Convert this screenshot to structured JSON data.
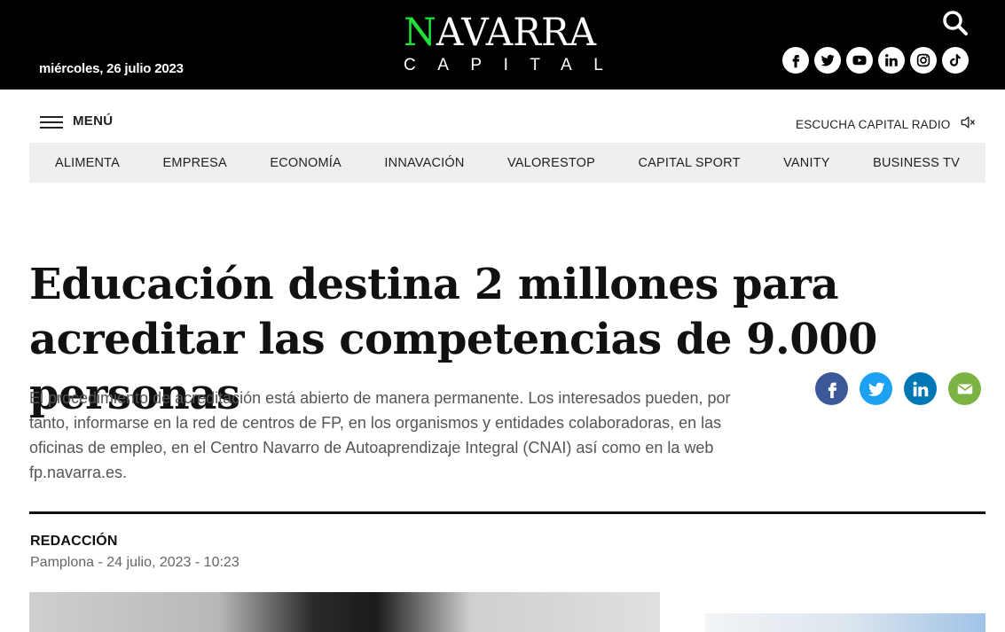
{
  "header": {
    "date": "miércoles, 26 julio 2023",
    "logo_accent": "N",
    "logo_rest": "AVARRA",
    "logo_sub": "CAPITAL",
    "socials": [
      "facebook-icon",
      "twitter-icon",
      "youtube-icon",
      "linkedin-icon",
      "instagram-icon",
      "tiktok-icon"
    ]
  },
  "menu": {
    "label": "MENÚ",
    "radio_label": "ESCUCHA CAPITAL RADIO"
  },
  "nav": {
    "items": [
      "ALIMENTA",
      "EMPRESA",
      "ECONOMÍA",
      "INNAVACIÓN",
      "VALORESTOP",
      "CAPITAL SPORT",
      "VANITY",
      "BUSINESS TV"
    ]
  },
  "article": {
    "headline": "Educación destina 2 millones para acreditar las competencias de 9.000 personas",
    "lead": "El procedimiento de acreditación está abierto de manera permanente. Los interesados pueden, por tanto, informarse en la red de centros de FP, en los organismos y entidades colaboradoras, en las oficinas de empleo, en el Centro Navarro de Autoaprendizaje Integral (CNAI) así como en la web fp.navarra.es.",
    "author": "REDACCIÓN",
    "meta": "Pamplona - 24 julio, 2023 - 10:23"
  },
  "share": [
    "facebook-share-icon",
    "twitter-share-icon",
    "linkedin-share-icon",
    "email-share-icon"
  ],
  "colors": {
    "accent": "#22e03a",
    "facebook": "#3b5998",
    "twitter": "#1da1f2",
    "linkedin": "#0077b5",
    "email": "#7cb342"
  }
}
